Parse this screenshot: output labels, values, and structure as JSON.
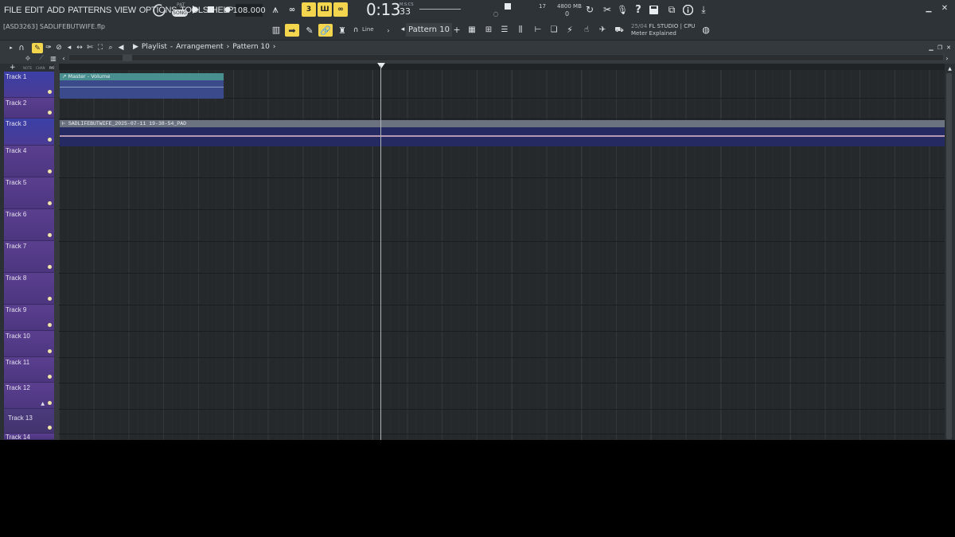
{
  "menu": [
    "FILE",
    "EDIT",
    "ADD",
    "PATTERNS",
    "VIEW",
    "OPTIONS",
    "TOOLS",
    "HELP"
  ],
  "transport": {
    "mode_top": "PAT",
    "mode": "SONG",
    "tempo": "108.000",
    "time_main": "0:13",
    "time_sub": "33",
    "time_label": "M:S:CS"
  },
  "monitor": {
    "voices": "17",
    "memory": "4800 MB",
    "cpu_num": "0"
  },
  "hint": {
    "line1_prefix": "25/04",
    "line1": "FL STUDIO | CPU",
    "line2": "Meter Explained"
  },
  "project": {
    "id": "[ASD3263]",
    "file": "SADLIFEBUTWIFE.flp"
  },
  "toolbar2": {
    "snap": "Line",
    "pattern": "Pattern 10"
  },
  "playlist": {
    "crumb1": "Playlist",
    "crumb2": "Arrangement",
    "crumb3": "Pattern 10",
    "tabs": [
      "NOTE",
      "CHAN",
      "PAT"
    ]
  },
  "tracks": [
    "Track 1",
    "Track 2",
    "Track 3",
    "Track 4",
    "Track 5",
    "Track 6",
    "Track 7",
    "Track 8",
    "Track 9",
    "Track 10",
    "Track 11",
    "Track 12",
    "Track 13",
    "Track 14"
  ],
  "clips": {
    "automation": "Master - Volume",
    "audio": "SADLIFEBUTWIFE_2025-07-11 19-38-54_PAD"
  }
}
